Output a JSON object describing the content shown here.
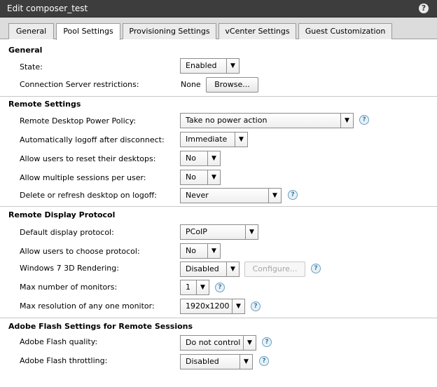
{
  "window": {
    "title": "Edit composer_test",
    "help_icon": "?"
  },
  "tabs": [
    {
      "label": "General"
    },
    {
      "label": "Pool Settings",
      "active": true
    },
    {
      "label": "Provisioning Settings"
    },
    {
      "label": "vCenter Settings"
    },
    {
      "label": "Guest Customization"
    }
  ],
  "sections": {
    "general": {
      "title": "General",
      "state_label": "State:",
      "state_value": "Enabled",
      "conn_label": "Connection Server restrictions:",
      "conn_value": "None",
      "browse_label": "Browse..."
    },
    "remote": {
      "title": "Remote Settings",
      "power_label": "Remote Desktop Power Policy:",
      "power_value": "Take no power action",
      "logoff_label": "Automatically logoff after disconnect:",
      "logoff_value": "Immediate",
      "reset_label": "Allow users to reset their desktops:",
      "reset_value": "No",
      "multi_label": "Allow multiple sessions per user:",
      "multi_value": "No",
      "refresh_label": "Delete or refresh desktop on logoff:",
      "refresh_value": "Never"
    },
    "display": {
      "title": "Remote Display Protocol",
      "protocol_label": "Default display protocol:",
      "protocol_value": "PCoIP",
      "choose_label": "Allow users to choose protocol:",
      "choose_value": "No",
      "render_label": "Windows 7 3D Rendering:",
      "render_value": "Disabled",
      "configure_label": "Configure...",
      "monitors_label": "Max number of monitors:",
      "monitors_value": "1",
      "resolution_label": "Max resolution of any one monitor:",
      "resolution_value": "1920x1200"
    },
    "flash": {
      "title": "Adobe Flash Settings for Remote Sessions",
      "quality_label": "Adobe Flash quality:",
      "quality_value": "Do not control",
      "throttle_label": "Adobe Flash throttling:",
      "throttle_value": "Disabled"
    }
  },
  "icons": {
    "dropdown_arrow": "▼",
    "help": "?"
  }
}
